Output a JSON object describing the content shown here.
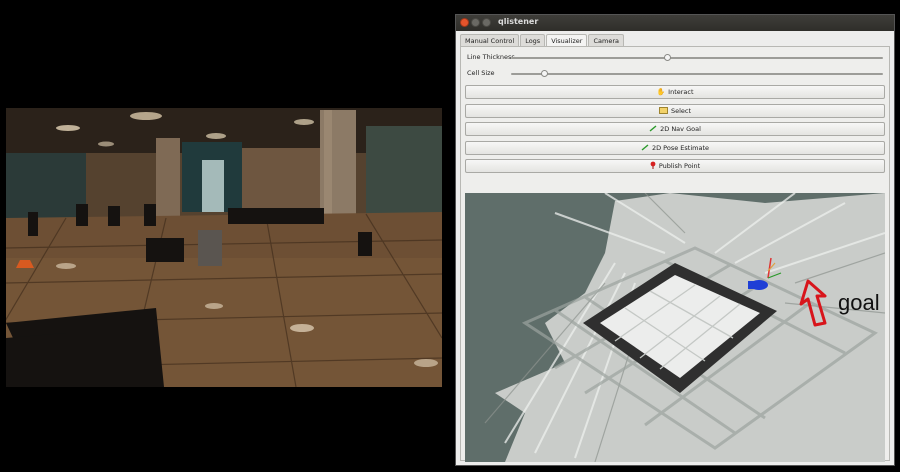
{
  "window": {
    "title": "qlistener"
  },
  "tabs": [
    {
      "label": "Manual Control",
      "active": false
    },
    {
      "label": "Logs",
      "active": false
    },
    {
      "label": "Visualizer",
      "active": true
    },
    {
      "label": "Camera",
      "active": false
    }
  ],
  "controls": {
    "line_thickness": {
      "label": "Line Thickness",
      "level": 0.42
    },
    "cell_size": {
      "label": "Cell Size",
      "level": 0.09
    }
  },
  "toolbar": {
    "interact": {
      "label": "Interact",
      "icon": "hand-icon"
    },
    "select": {
      "label": "Select",
      "icon": "select-rectangle-icon"
    },
    "nav_goal": {
      "label": "2D Nav Goal",
      "icon": "green-arrow-icon"
    },
    "pose_estimate": {
      "label": "2D Pose Estimate",
      "icon": "green-arrow-icon"
    },
    "publish_point": {
      "label": "Publish Point",
      "icon": "red-pin-icon"
    }
  },
  "visualizer": {
    "annotation": "goal",
    "colors": {
      "background": "#5f6e6a",
      "map_free": "#c9ccc9",
      "grid_dark": "#3a3a3a",
      "robot": "#1f3fd6",
      "goal_arrow": "#d8151b"
    }
  }
}
